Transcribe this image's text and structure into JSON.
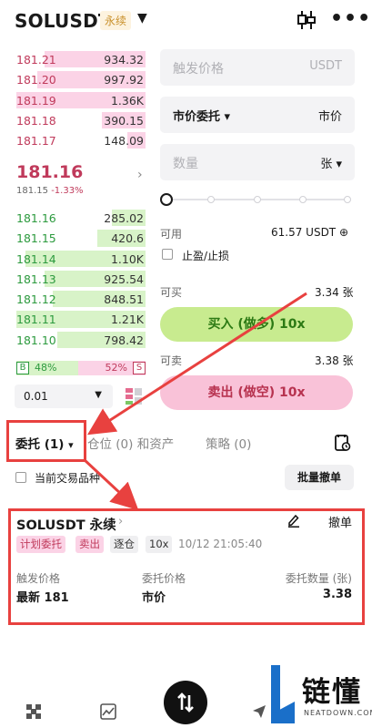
{
  "header": {
    "symbol": "SOLUSDT",
    "tag": "永续",
    "caret": "▼",
    "more": "•••"
  },
  "orderbook": {
    "asks": [
      {
        "price": "181.21",
        "qty": "934.32",
        "depth": 0.78
      },
      {
        "price": "181.20",
        "qty": "997.92",
        "depth": 0.84
      },
      {
        "price": "181.19",
        "qty": "1.36K",
        "depth": 1.0
      },
      {
        "price": "181.18",
        "qty": "390.15",
        "depth": 0.34
      },
      {
        "price": "181.17",
        "qty": "148.09",
        "depth": 0.14
      }
    ],
    "last_price": "181.16",
    "mark_price": "181.15",
    "change": "-1.33%",
    "bids": [
      {
        "price": "181.16",
        "qty": "285.02",
        "depth": 0.26
      },
      {
        "price": "181.15",
        "qty": "420.6",
        "depth": 0.37
      },
      {
        "price": "181.14",
        "qty": "1.10K",
        "depth": 0.93
      },
      {
        "price": "181.13",
        "qty": "925.54",
        "depth": 0.78
      },
      {
        "price": "181.12",
        "qty": "848.51",
        "depth": 0.72
      },
      {
        "price": "181.11",
        "qty": "1.21K",
        "depth": 1.0
      },
      {
        "price": "181.10",
        "qty": "798.42",
        "depth": 0.68
      }
    ],
    "buy_label": "B",
    "buy_pct": "48%",
    "sell_label": "S",
    "sell_pct": "52%",
    "precision": "0.01"
  },
  "form": {
    "trigger_placeholder": "触发价格",
    "trigger_unit": "USDT",
    "order_type": "市价委托 ▾",
    "order_type_value": "市价",
    "qty_placeholder": "数量",
    "qty_unit": "张 ▾",
    "available_label": "可用",
    "available_value": "61.57 USDT ⊕",
    "tpsl_label": "止盈/止损",
    "can_buy_label": "可买",
    "can_buy_value": "3.34 张",
    "buy_button": "买入 (做多) 10x",
    "can_sell_label": "可卖",
    "can_sell_value": "3.38 张",
    "sell_button": "卖出 (做空) 10x"
  },
  "tabs": {
    "orders": "委托 (1)",
    "orders_caret": "▾",
    "positions": "仓位 (0) 和资产",
    "strategy": "策略 (0)"
  },
  "filter": {
    "current_only": "当前交易品种",
    "bulk_cancel": "批量撤单"
  },
  "order": {
    "symbol": "SOLUSDT 永续",
    "arrow": "›",
    "cancel": "撤单",
    "badges": [
      "计划委托",
      "卖出",
      "逐仓",
      "10x"
    ],
    "time": "10/12 21:05:40",
    "trigger_label": "触发价格",
    "trigger_value": "最新 181",
    "price_label": "委托价格",
    "price_value": "市价",
    "qty_label": "委托数量 (张)",
    "qty_value": "3.38"
  },
  "watermark": {
    "brand": "链懂",
    "site": "NEATDOWN.COM"
  },
  "colors": {
    "ask": "#c03a5b",
    "bid": "#2c9a3e",
    "buy_btn": "#c8eb8f",
    "sell_btn": "#f9c2d8",
    "annotation": "#e8413f"
  }
}
